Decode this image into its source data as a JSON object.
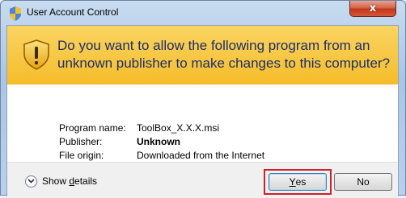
{
  "window": {
    "title": "User Account Control",
    "close_label": "x"
  },
  "banner": {
    "question": "Do you want to allow the following program from an unknown publisher to make changes to this computer?"
  },
  "details": {
    "rows": [
      {
        "label": "Program name:",
        "value": "ToolBox_X.X.X.msi"
      },
      {
        "label": "Publisher:",
        "value": "Unknown"
      },
      {
        "label": "File origin:",
        "value": "Downloaded from the Internet"
      }
    ]
  },
  "footer": {
    "show_details_prefix": "Show ",
    "show_details_mnemonic": "d",
    "show_details_suffix": "etails",
    "yes_mnemonic": "Y",
    "yes_suffix": "es",
    "no_label": "No"
  },
  "colors": {
    "banner": "#f5bc2a",
    "question_text": "#1c2f6b",
    "highlight": "#d0202a",
    "close_button": "#c1381b"
  },
  "icons": {
    "title": "uac-shield-icon",
    "banner": "warning-shield-icon",
    "show_details": "chevron-down-icon"
  }
}
